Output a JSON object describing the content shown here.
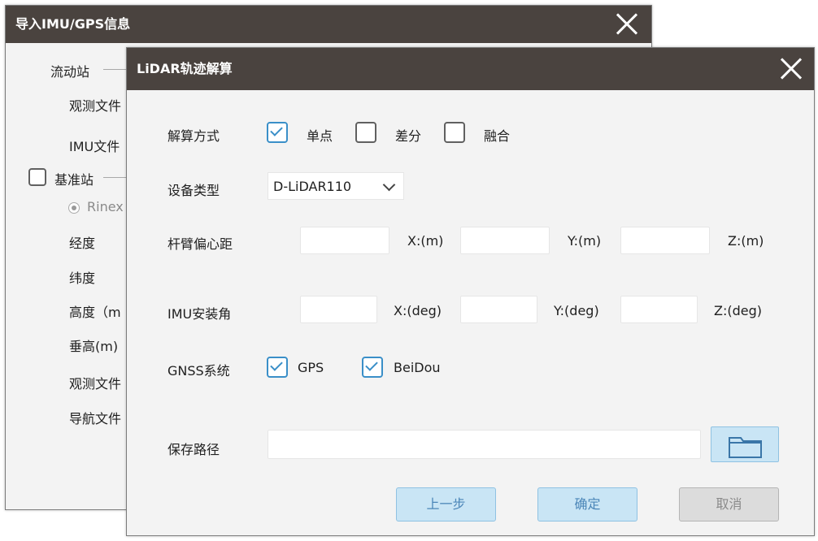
{
  "back_dialog": {
    "title": "导入IMU/GPS信息",
    "rover_label": "流动站",
    "obs_file_label": "观测文件",
    "imu_file_label": "IMU文件",
    "base_station_label": "基准站",
    "rinex_label": "Rinex",
    "longitude_label": "经度",
    "latitude_label": "纬度",
    "height_label": "高度（m",
    "vertical_height_label": "垂高(m)",
    "obs_file2_label": "观测文件",
    "nav_file_label": "导航文件"
  },
  "front_dialog": {
    "title": "LiDAR轨迹解算",
    "solve_mode": {
      "label": "解算方式",
      "options": [
        {
          "label": "单点",
          "checked": true
        },
        {
          "label": "差分",
          "checked": false
        },
        {
          "label": "融合",
          "checked": false
        }
      ]
    },
    "device_type": {
      "label": "设备类型",
      "value": "D-LiDAR110"
    },
    "lever_arm": {
      "label": "杆臂偏心距",
      "x": "X:(m)",
      "y": "Y:(m)",
      "z": "Z:(m)"
    },
    "imu_angle": {
      "label": "IMU安装角",
      "x": "X:(deg)",
      "y": "Y:(deg)",
      "z": "Z:(deg)"
    },
    "gnss": {
      "label": "GNSS系统",
      "options": [
        {
          "label": "GPS",
          "checked": true
        },
        {
          "label": "BeiDou",
          "checked": true
        }
      ]
    },
    "save_path": {
      "label": "保存路径",
      "value": ""
    },
    "buttons": {
      "prev": "上一步",
      "ok": "确定",
      "cancel": "取消"
    }
  }
}
